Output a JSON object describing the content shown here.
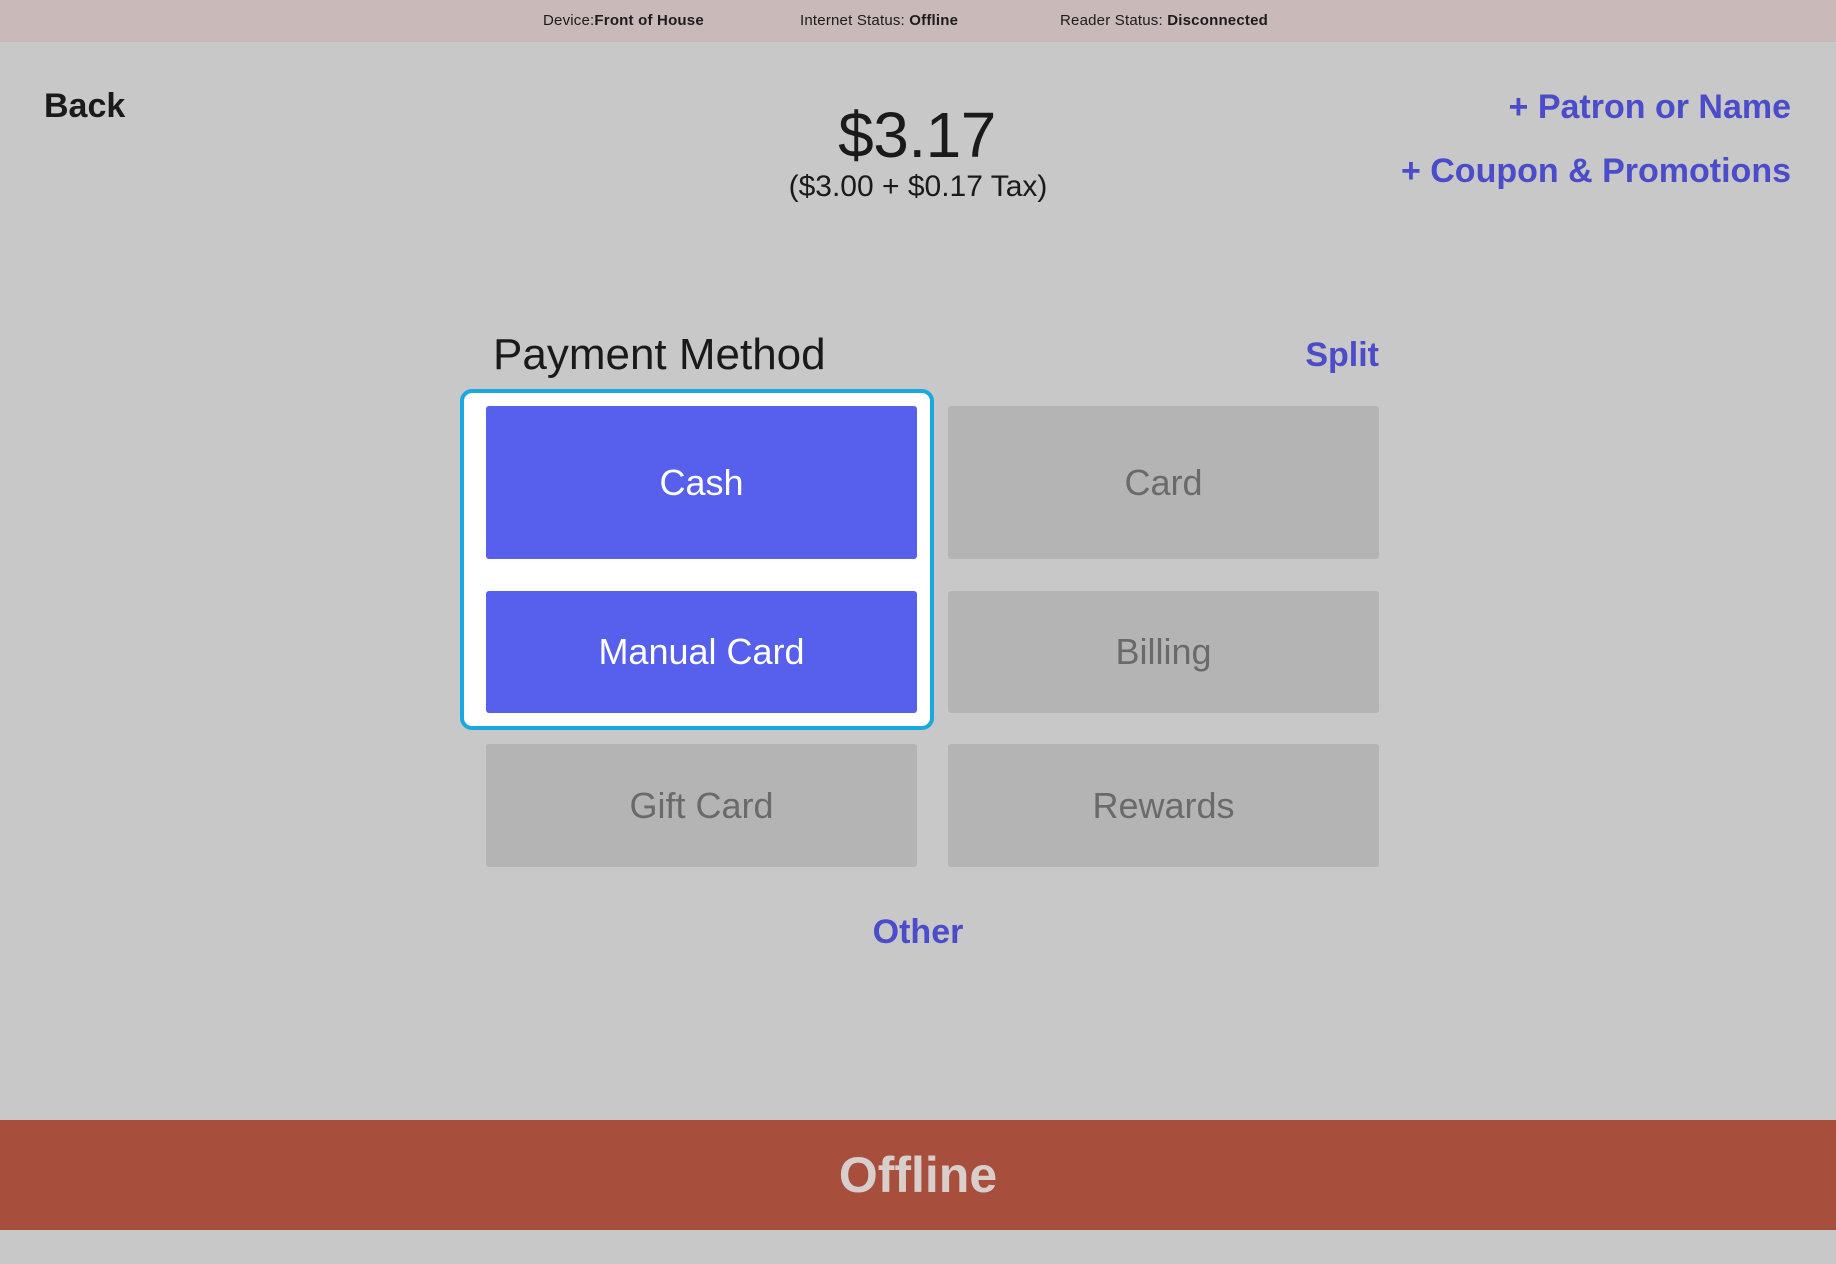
{
  "status_bar": {
    "device_label": "Device:",
    "device_value": "Front of House",
    "internet_label": "Internet Status: ",
    "internet_value": "Offline",
    "reader_label": "Reader Status: ",
    "reader_value": "Disconnected"
  },
  "header": {
    "back_label": "Back",
    "amount": "$3.17",
    "amount_detail": "($3.00 + $0.17 Tax)",
    "patron_link": "+ Patron or Name",
    "coupon_link": "+ Coupon & Promotions"
  },
  "payment": {
    "title": "Payment Method",
    "split_label": "Split",
    "methods": [
      {
        "label": "Cash",
        "state": "active"
      },
      {
        "label": "Card",
        "state": "inactive"
      },
      {
        "label": "Manual Card",
        "state": "active"
      },
      {
        "label": "Billing",
        "state": "inactive"
      },
      {
        "label": "Gift Card",
        "state": "inactive"
      },
      {
        "label": "Rewards",
        "state": "inactive"
      }
    ],
    "other_label": "Other"
  },
  "footer": {
    "offline_label": "Offline"
  },
  "colors": {
    "accent": "#5660ec",
    "link": "#4a4cc9",
    "highlight_border": "#1aa8e0",
    "offline_bar": "#a84e3d",
    "inactive_button": "#b4b4b4"
  }
}
